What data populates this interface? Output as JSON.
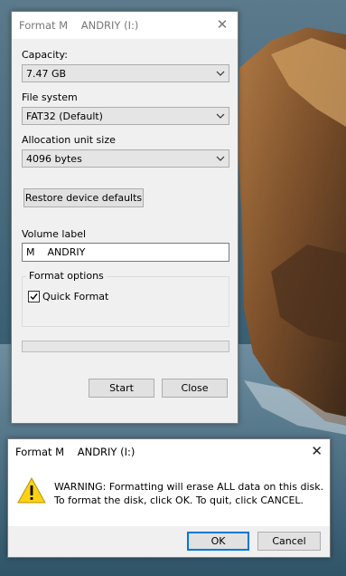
{
  "format_dialog": {
    "title": "Format M    ANDRIY (I:)",
    "capacity_label": "Capacity:",
    "capacity_value": "7.47 GB",
    "filesystem_label": "File system",
    "filesystem_value": "FAT32 (Default)",
    "allocation_label": "Allocation unit size",
    "allocation_value": "4096 bytes",
    "restore_button": "Restore device defaults",
    "volume_label": "Volume label",
    "volume_value": "M    ANDRIY",
    "format_options_label": "Format options",
    "quick_format_label": "Quick Format",
    "quick_format_checked": true,
    "progress": 0,
    "start_button": "Start",
    "close_button": "Close"
  },
  "warning_dialog": {
    "title": "Format M    ANDRIY (I:)",
    "message_line1": "WARNING: Formatting will erase ALL data on this disk.",
    "message_line2": "To format the disk, click OK. To quit, click CANCEL.",
    "ok_button": "OK",
    "cancel_button": "Cancel",
    "icon": "warning-icon"
  }
}
